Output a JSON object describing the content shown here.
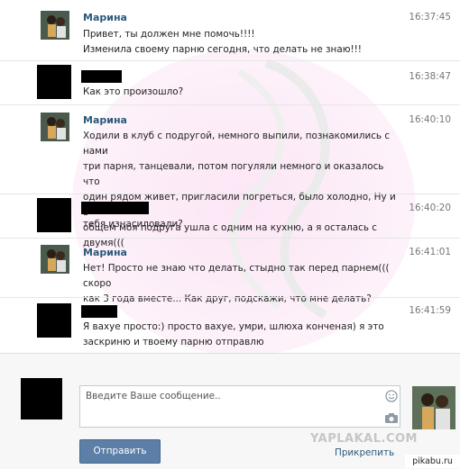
{
  "messages": [
    {
      "author": "Марина",
      "time": "16:37:45",
      "lines": [
        "Привет, ты должен мне помочь!!!!",
        "Изменила своему парню сегодня, что делать не знаю!!!"
      ]
    },
    {
      "author": "",
      "time": "16:38:47",
      "lines": [
        "Как это произошло?"
      ]
    },
    {
      "author": "Марина",
      "time": "16:40:10",
      "lines": [
        "Ходили в клуб с подругой, немного выпили, познакомились с нами",
        "три парня, танцевали, потом погуляли немного и оказалось что",
        "один рядом живет, пригласили погреться, было холодно, Ну и в",
        "общем моя подруга ушла с одним на кухню, а я осталась с двумя((("
      ]
    },
    {
      "author": "",
      "time": "16:40:20",
      "lines": [
        "тебя изнасиловали?"
      ]
    },
    {
      "author": "Марина",
      "time": "16:41:01",
      "lines": [
        "Нет! Просто не знаю что делать, стыдно так перед парнем((( скоро",
        "как 3 года вместе... Как друг, подскажи, что мне делать?"
      ]
    },
    {
      "author": "",
      "time": "16:41:59",
      "lines": [
        "Я вахуе просто:) просто вахуе, умри, шлюха конченая) я это",
        "заскриню и твоему парню отправлю"
      ]
    }
  ],
  "composer": {
    "placeholder": "Введите Ваше сообщение..",
    "send_label": "Отправить",
    "attach_label": "Прикрепить"
  },
  "watermark": "YAPLAKAL.COM",
  "corner_badge": "pikabu.ru",
  "icons": {
    "smile": "smile-icon",
    "camera": "camera-icon"
  },
  "colors": {
    "name": "#2b587a",
    "button": "#5b7fa6",
    "time": "#777777"
  }
}
